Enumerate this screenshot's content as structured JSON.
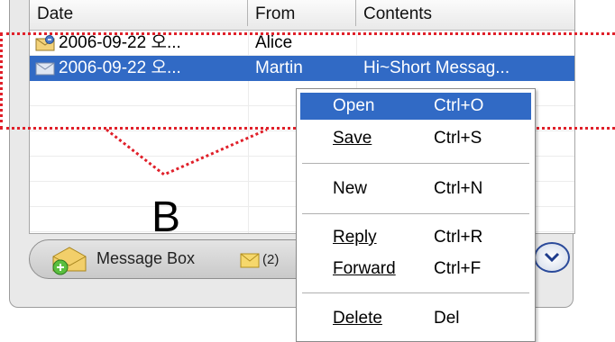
{
  "columns": {
    "date": "Date",
    "from": "From",
    "contents": "Contents"
  },
  "messages": [
    {
      "date": "2006-09-22 오...",
      "from": "Alice",
      "contents": "",
      "icon": "message-reply-icon"
    },
    {
      "date": "2006-09-22 오...",
      "from": "Martin",
      "contents": "Hi~Short Messag...",
      "icon": "envelope-icon"
    }
  ],
  "bottom_bar": {
    "label": "Message Box",
    "count": "(2)",
    "icon": "message-box-icon",
    "unread_icon": "envelope-icon",
    "expand_icon": "chevron-down-icon"
  },
  "context_menu": {
    "items": [
      {
        "label": "Open",
        "shortcut": "Ctrl+O",
        "highlighted": true
      },
      {
        "label": "Save",
        "shortcut": "Ctrl+S"
      },
      {
        "label": "New",
        "shortcut": "Ctrl+N"
      },
      {
        "label": "Reply",
        "shortcut": "Ctrl+R"
      },
      {
        "label": "Forward",
        "shortcut": "Ctrl+F"
      },
      {
        "label": "Delete",
        "shortcut": "Del"
      }
    ]
  },
  "callout": {
    "label": "B",
    "color": "#e0202a"
  },
  "colors": {
    "selection": "#316ac5",
    "annotation": "#e0202a"
  }
}
